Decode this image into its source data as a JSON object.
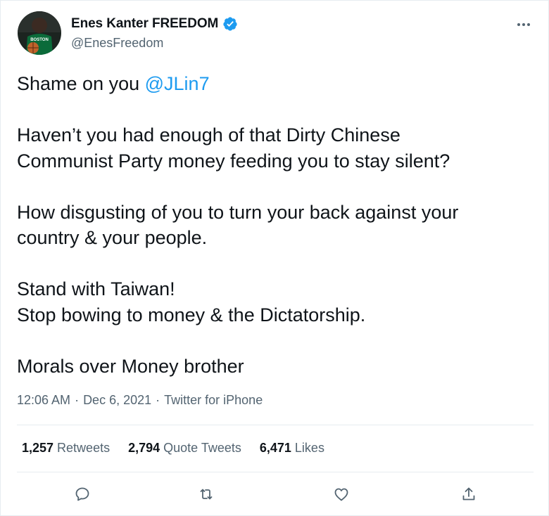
{
  "author": {
    "name": "Enes Kanter FREEDOM",
    "handle": "@EnesFreedom",
    "avatar_jersey_text": "BOSTON"
  },
  "tweet": {
    "line1_prefix": "Shame on you ",
    "line1_mention": "@JLin7",
    "para2_line1": "Haven’t you had enough of that Dirty Chinese",
    "para2_line2": "Communist Party money feeding you to stay silent?",
    "para3_line1": "How disgusting of you to turn your back against your",
    "para3_line2": "country & your people.",
    "para4_line1": "Stand with Taiwan!",
    "para4_line2": "Stop bowing to money & the Dictatorship.",
    "para5_line1": "Morals over Money brother"
  },
  "meta": {
    "time": "12:06 AM",
    "sep1": "·",
    "date": "Dec 6, 2021",
    "sep2": "·",
    "source": "Twitter for iPhone"
  },
  "stats": {
    "retweets_count": "1,257",
    "retweets_label": "Retweets",
    "quotes_count": "2,794",
    "quotes_label": "Quote Tweets",
    "likes_count": "6,471",
    "likes_label": "Likes"
  },
  "actions": [
    "reply-icon",
    "retweet-icon",
    "like-icon",
    "share-icon"
  ],
  "colors": {
    "accent": "#1d9bf0",
    "text": "#0f1419",
    "secondary": "#536471",
    "border": "#e6ecf0"
  }
}
